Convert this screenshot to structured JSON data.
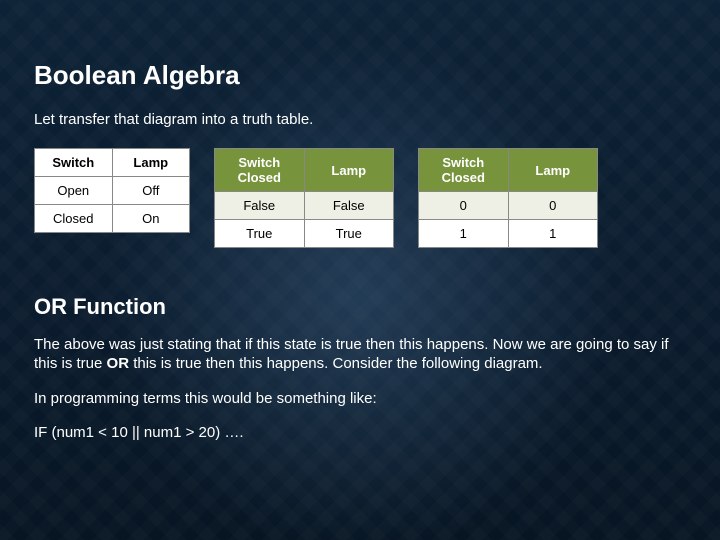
{
  "title": "Boolean Algebra",
  "intro": "Let transfer that diagram into a truth table.",
  "chart_data": [
    {
      "type": "table",
      "headers": [
        "Switch",
        "Lamp"
      ],
      "rows": [
        [
          "Open",
          "Off"
        ],
        [
          "Closed",
          "On"
        ]
      ]
    },
    {
      "type": "table",
      "headers": [
        "Switch Closed",
        "Lamp"
      ],
      "rows": [
        [
          "False",
          "False"
        ],
        [
          "True",
          "True"
        ]
      ]
    },
    {
      "type": "table",
      "headers": [
        "Switch Closed",
        "Lamp"
      ],
      "rows": [
        [
          "0",
          "0"
        ],
        [
          "1",
          "1"
        ]
      ]
    }
  ],
  "subhead": "OR Function",
  "para1_a": "The above was just stating that if this state is true then this happens.  Now we are going to say if this is true ",
  "para1_bold": "OR",
  "para1_b": " this is true then this happens.  Consider the following diagram.",
  "para2": "In programming terms this would be something like:",
  "para3": "IF (num1 < 10 || num1 > 20) …."
}
